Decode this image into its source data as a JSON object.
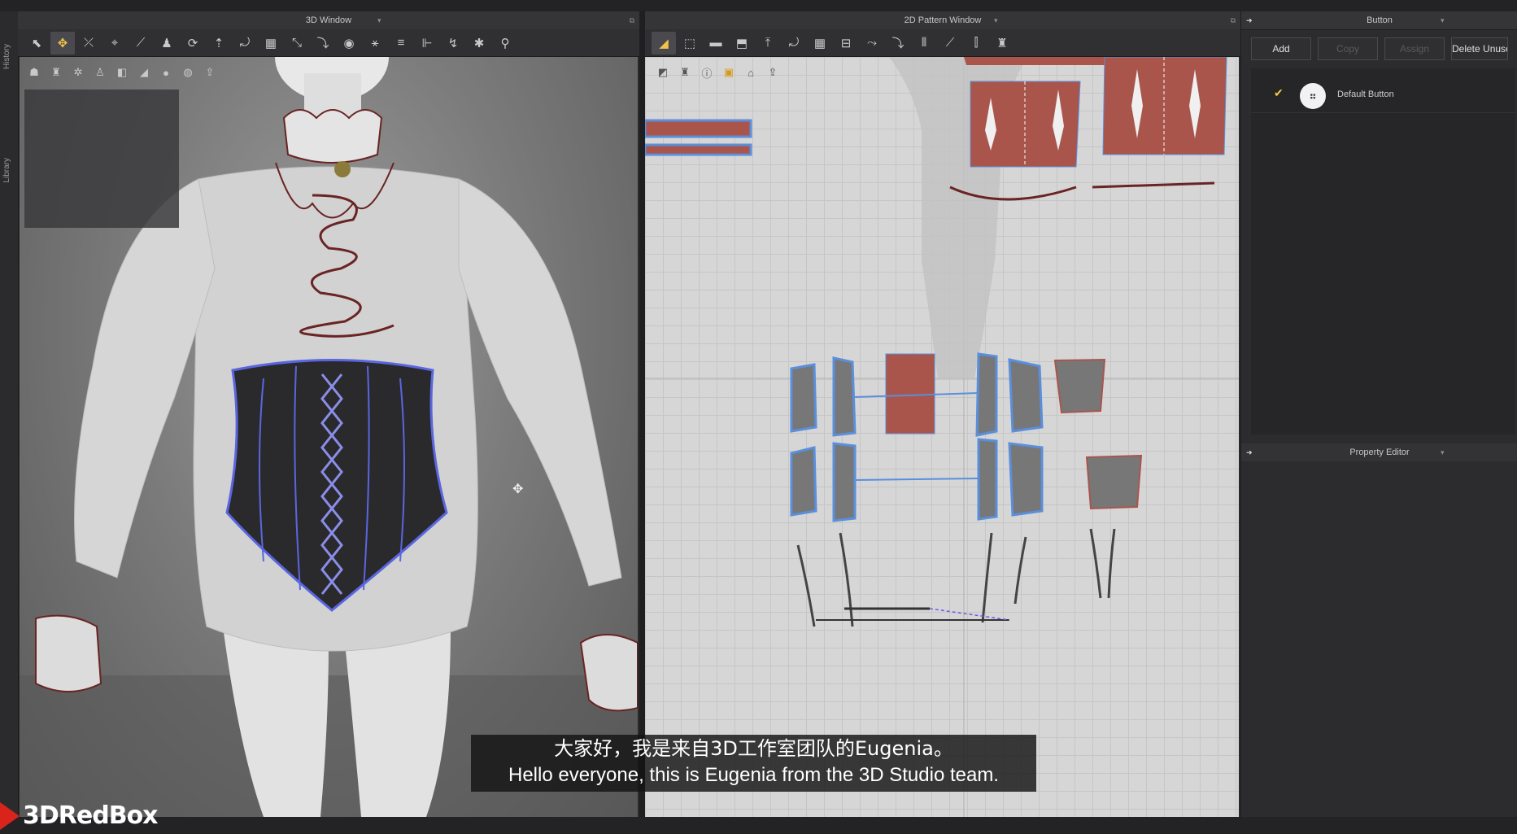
{
  "side_tabs": [
    "History",
    "Library"
  ],
  "window3d": {
    "title": "3D Window",
    "tools": [
      "select-icon",
      "move-icon",
      "edit-point-icon",
      "pin-icon",
      "measure-icon",
      "avatar-icon",
      "rotate-icon",
      "arrange-icon",
      "fold-icon",
      "grid-icon",
      "tack-icon",
      "sewing-icon",
      "button-icon",
      "topstitch-icon",
      "seam-icon",
      "brush-icon",
      "pose-icon",
      "figure-icon"
    ],
    "sub_tools": [
      "avatar-show-icon",
      "garment-show-icon",
      "texture-icon",
      "skin-icon",
      "light-icon",
      "shadow-icon",
      "avatar-color-icon",
      "fabric-icon",
      "export-icon"
    ]
  },
  "window2d": {
    "title": "2D Pattern Window",
    "tools": [
      "transform-pattern-icon",
      "edit-pattern-icon",
      "rectangle-icon",
      "polygon-icon",
      "trace-icon",
      "seam-icon",
      "grid-icon",
      "fold-icon",
      "sew-icon",
      "segment-sew-icon",
      "free-sew-icon",
      "measure-icon",
      "notch-icon",
      "garment-icon"
    ],
    "sub_tools": [
      "pattern-icon",
      "avatar-icon",
      "info-icon",
      "texture-icon",
      "lock-icon",
      "export-icon"
    ]
  },
  "button_panel": {
    "title": "Button",
    "buttons": {
      "add": "Add",
      "copy": "Copy",
      "assign": "Assign",
      "delete_unused": "Delete Unuse"
    },
    "items": [
      {
        "label": "Default Button",
        "checked": true
      }
    ]
  },
  "property_editor": {
    "title": "Property Editor"
  },
  "subtitle": {
    "zh": "大家好，我是来自3D工作室团队的Eugenia。",
    "en": "Hello everyone, this is Eugenia from the 3D Studio team."
  },
  "logo": {
    "text": "3DRedBox"
  },
  "colors": {
    "accent": "#f2c744",
    "brand_red": "#d9241c",
    "pattern_fill": "#a9554c",
    "outline_blue": "#5a8fdc"
  }
}
